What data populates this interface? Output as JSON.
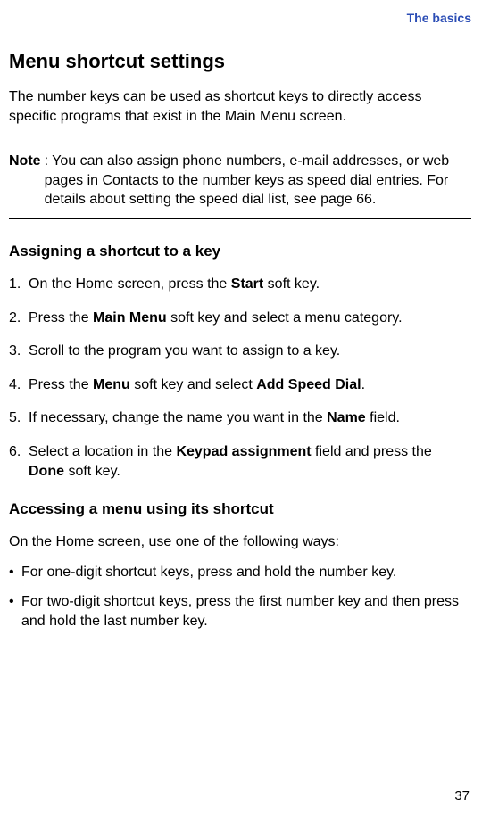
{
  "chapter": "The basics",
  "section_title": "Menu shortcut settings",
  "intro": "The number keys can be used as shortcut keys to directly access specific programs that exist in the Main Menu screen.",
  "note_label": "Note",
  "note_text": ": You can also assign phone numbers, e-mail addresses, or web pages in Contacts to the number keys as speed dial entries. For details about setting the speed dial list, see page 66.",
  "subsection1_title": "Assigning a shortcut to a key",
  "steps": [
    {
      "num": "1.",
      "pre": "On the Home screen, press the ",
      "b1": "Start",
      "post": " soft key."
    },
    {
      "num": "2.",
      "pre": "Press the ",
      "b1": "Main Menu",
      "post": " soft key and select a menu category."
    },
    {
      "num": "3.",
      "pre": "Scroll to the program you want to assign to a key.",
      "b1": "",
      "post": ""
    },
    {
      "num": "4.",
      "pre": "Press the ",
      "b1": "Menu",
      "mid": " soft key and select ",
      "b2": "Add Speed Dial",
      "post": "."
    },
    {
      "num": "5.",
      "pre": "If necessary, change the name you want in the ",
      "b1": "Name",
      "post": " field."
    },
    {
      "num": "6.",
      "pre": "Select a location in the ",
      "b1": "Keypad assignment",
      "mid": " field and press the ",
      "b2": "Done",
      "post": " soft key."
    }
  ],
  "subsection2_title": "Accessing a menu using its shortcut",
  "access_intro": "On the Home screen, use one of the following ways:",
  "bullets": [
    "For one-digit shortcut keys, press and hold the number key.",
    "For two-digit shortcut keys, press the first number key and then press and hold the last number key."
  ],
  "page_number": "37"
}
